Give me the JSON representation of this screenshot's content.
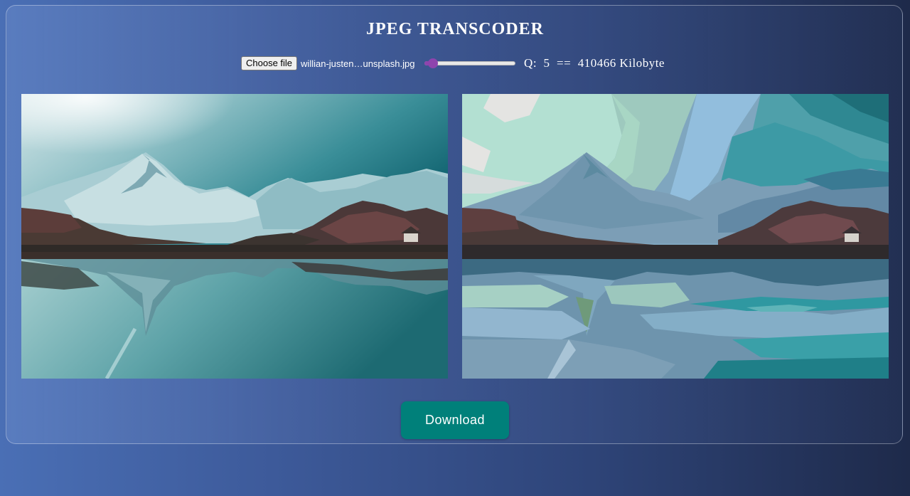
{
  "app": {
    "title": "JPEG TRANSCODER"
  },
  "controls": {
    "choose_file_label": "Choose file",
    "file_name": "willian-justen…unsplash.jpg",
    "quality_slider": {
      "min": 1,
      "max": 100,
      "value": 5,
      "accent_color": "#8e44ad"
    },
    "q_label": "Q:",
    "q_value": "5",
    "equals": "==",
    "size_value": "410466",
    "size_unit": "Kilobyte"
  },
  "images": {
    "original_alt": "Original mountain lake photo",
    "transcoded_alt": "Transcoded JPEG preview (low quality)"
  },
  "actions": {
    "download_label": "Download",
    "download_color": "#00807a"
  },
  "theme": {
    "background_start": "#4a6fb5",
    "background_end": "#1e2a4a"
  }
}
